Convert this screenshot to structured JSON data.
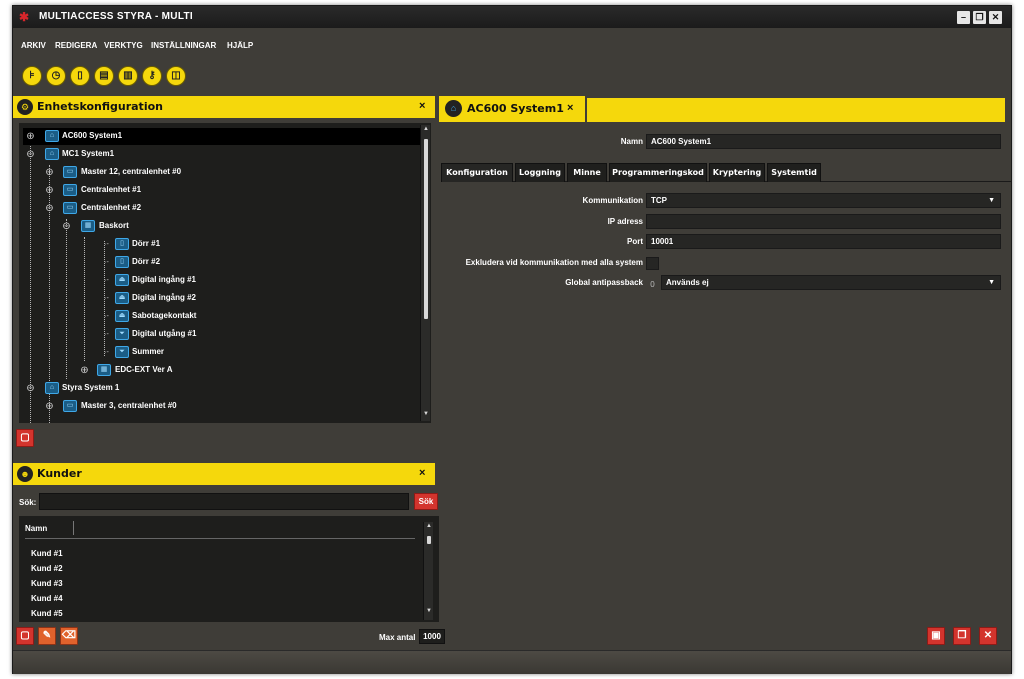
{
  "window": {
    "title": "MULTIACCESS STYRA - MULTI",
    "controls": [
      "minimize-icon",
      "restore-icon",
      "close-icon"
    ]
  },
  "menu": [
    "ARKIV",
    "REDIGERA",
    "VERKTYG",
    "INSTÄLLNINGAR",
    "HJÄLP"
  ],
  "toolbar": [
    "device-tree-icon",
    "clock-icon",
    "door-icon",
    "building-icon",
    "card-icon",
    "key-icon",
    "book-icon"
  ],
  "colors": {
    "accent": "#f5d80c",
    "background": "#3f3d38",
    "panel": "#1e1e1c",
    "danger": "#d3342d",
    "tree_icon": "#3fa8e8"
  },
  "device_panel": {
    "title": "Enhetskonfiguration",
    "close": "×",
    "tree": [
      "AC600 System1",
      "MC1 System1",
      "Master 12, centralenhet #0",
      "Centralenhet #1",
      "Centralenhet #2",
      "Baskort",
      "Dörr #1",
      "Dörr #2",
      "Digital ingång #1",
      "Digital ingång #2",
      "Sabotagekontakt",
      "Digital utgång #1",
      "Summer",
      "EDC-EXT Ver A",
      "Styra System 1",
      "Master 3, centralenhet #0"
    ],
    "selected": "AC600 System1"
  },
  "customers_panel": {
    "title": "Kunder",
    "close": "×",
    "search_label": "Sök:",
    "search_value": "",
    "search_button": "Sök",
    "column": "Namn",
    "rows": [
      "Kund #1",
      "Kund #2",
      "Kund #3",
      "Kund #4",
      "Kund #5"
    ],
    "max_label": "Max antal",
    "max_value": "1000"
  },
  "editor": {
    "tab_title": "AC600 System1",
    "tab_close": "×",
    "name_label": "Namn",
    "name_value": "AC600 System1",
    "tabs": [
      "Konfiguration",
      "Loggning",
      "Minne",
      "Programmeringskod",
      "Kryptering",
      "Systemtid"
    ],
    "active_tab": "Konfiguration",
    "fields": {
      "kommunikation_label": "Kommunikation",
      "kommunikation_value": "TCP",
      "ip_label": "IP adress",
      "ip_value": "",
      "port_label": "Port",
      "port_value": "10001",
      "exkludera_label": "Exkludera vid kommunikation med alla system",
      "exkludera_checked": false,
      "antipassback_label": "Global antipassback",
      "antipassback_zero": "0",
      "antipassback_value": "Används ej"
    },
    "bottom_buttons": [
      "save-icon",
      "copy-icon",
      "close-icon"
    ]
  }
}
